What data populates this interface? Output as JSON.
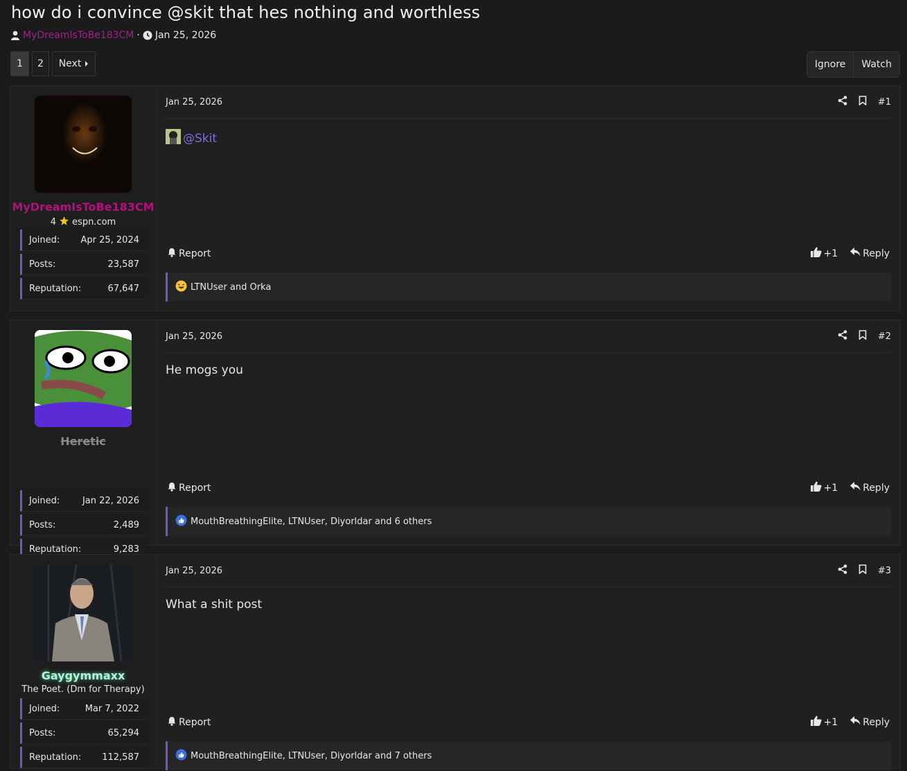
{
  "thread": {
    "title": "how do i convince @skit that hes nothing and worthless",
    "author": "MyDreamIsToBe183CM",
    "separator": "·",
    "date": "Jan 25, 2026"
  },
  "pager": {
    "current": "1",
    "page2": "2",
    "next": "Next"
  },
  "actions": {
    "ignore": "Ignore",
    "watch": "Watch"
  },
  "labels": {
    "report": "Report",
    "reply": "Reply",
    "plus_one": "+1",
    "joined": "Joined:",
    "posts": "Posts:",
    "reputation": "Reputation:"
  },
  "posts": [
    {
      "date": "Jan 25, 2026",
      "number": "#1",
      "user": {
        "name": "MyDreamIsToBe183CM",
        "title_num": "4",
        "title_text": "espn.com",
        "joined": "Apr 25, 2024",
        "posts": "23,587",
        "reputation": "67,647"
      },
      "body": "@Skit",
      "reactions": "LTNUser and Orka"
    },
    {
      "date": "Jan 25, 2026",
      "number": "#2",
      "user": {
        "name": "Heretic",
        "joined": "Jan 22, 2026",
        "posts": "2,489",
        "reputation": "9,283"
      },
      "body": "He mogs you",
      "reactions": "MouthBreathingElite, LTNUser, Diyorldar and 6 others"
    },
    {
      "date": "Jan 25, 2026",
      "number": "#3",
      "user": {
        "name": "Gaygymmaxx",
        "title_text": "The Poet. (Dm for Therapy)",
        "joined": "Mar 7, 2022",
        "posts": "65,294",
        "reputation": "112,587"
      },
      "body": "What a shit post",
      "reactions": "MouthBreathingElite, LTNUser, Diyorldar and 7 others"
    }
  ],
  "colors": {
    "accent": "#6a5acd",
    "author": "#a0208a",
    "mention": "#7a6fe0"
  }
}
